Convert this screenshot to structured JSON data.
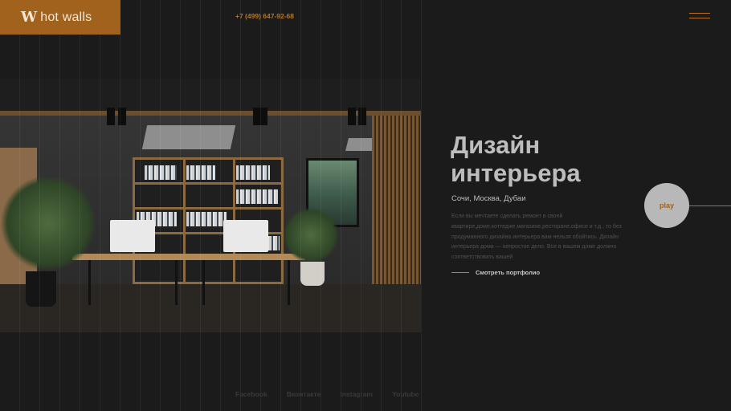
{
  "header": {
    "logo_mark": "W",
    "logo_text": "hot walls",
    "phone": "+7 (499) 647-92-68",
    "menu_icon": "hamburger-menu-icon"
  },
  "hero": {
    "title": "Дизайн интерьера",
    "cities": "Сочи, Москва, Дубаи",
    "description": "Если вы мечтаете сделать ремонт в своей квартире,доме,коттедже,магазине,ресторане,офисе и т.д., то без продуманного дизайна интерьера вам нельзя обойтись. Дизайн интерьера дома — непростое дело. Все в вашем доме должно соответствовать вашей",
    "portfolio_link": "Смотреть портфолио",
    "play_label": "play"
  },
  "socials": [
    "Facebook",
    "Вконтакте",
    "Instagram",
    "Youtube"
  ],
  "colors": {
    "accent": "#a0621d",
    "background": "#1b1b1b",
    "title": "#bdbdbd"
  }
}
